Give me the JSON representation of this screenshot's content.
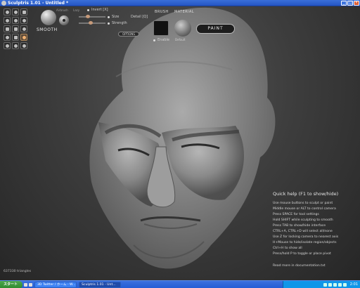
{
  "window": {
    "title": "Sculptris 1.01 - Untitled *",
    "buttons": [
      "_",
      "□",
      "×"
    ]
  },
  "toolbar": {
    "tools": [
      {
        "icon": "draw-icon",
        "active": false
      },
      {
        "icon": "flatten-icon",
        "active": false
      },
      {
        "icon": "crease-icon",
        "active": false
      },
      {
        "icon": "inflate-icon",
        "active": false
      },
      {
        "icon": "pinch-icon",
        "active": false
      },
      {
        "icon": "smooth-icon",
        "active": false
      },
      {
        "icon": "grab-icon",
        "active": false
      },
      {
        "icon": "scale-icon",
        "active": false
      },
      {
        "icon": "rotate-icon",
        "active": false
      },
      {
        "icon": "symmetry-icon",
        "active": false
      },
      {
        "icon": "wireframe-icon",
        "active": false
      },
      {
        "icon": "mask-icon",
        "active": true
      },
      {
        "icon": "reduce-icon",
        "active": false
      },
      {
        "icon": "undo-icon",
        "active": false
      },
      {
        "icon": "redo-icon",
        "active": false
      }
    ],
    "current_tool": "SMOOTH",
    "airbrush_label": "Airbrush",
    "lazy_label": "Lazy",
    "invert_label": "Invert [X]",
    "size_label": "Size",
    "strength_label": "Strength",
    "detail_label": "Detail [Q]",
    "options_label": "OPTIONS",
    "size_value": 0.3,
    "strength_value": 0.45
  },
  "brush": {
    "label": "BRUSH",
    "enable_label": "Enable"
  },
  "material": {
    "label": "MATERIAL",
    "name": "Default"
  },
  "paint_button": "PAINT",
  "help": {
    "title": "Quick help (F1 to show/hide)",
    "lines": [
      "Use mouse buttons to sculpt or paint",
      "Middle mouse or ALT to control camera",
      "Press SPACE for tool settings",
      "Hold SHIFT while sculpting to smooth",
      "Press TAB to show/hide interface",
      "CTRL+A, CTRL+D will select all/none",
      "Use Z for locking camera to nearest axis",
      "H+Mouse to hide/isolate region/objects",
      "Ctrl+H to show all",
      "Press/hold P to toggle or place pivot"
    ],
    "docs": "Read more in documentation.txt"
  },
  "status": {
    "triangles": "637330 triangles"
  },
  "taskbar": {
    "start": "スタート",
    "tasks": [
      {
        "label": "3D Twitter / ホーム - W...",
        "active": false
      },
      {
        "label": "Sculptris 1.01 - Unt...",
        "active": true
      }
    ],
    "clock": "2:01"
  },
  "colors": {
    "titlebar": "#2455c3",
    "taskbar": "#245dd5",
    "tray": "#0f96e8",
    "accent": "#f0b070"
  }
}
